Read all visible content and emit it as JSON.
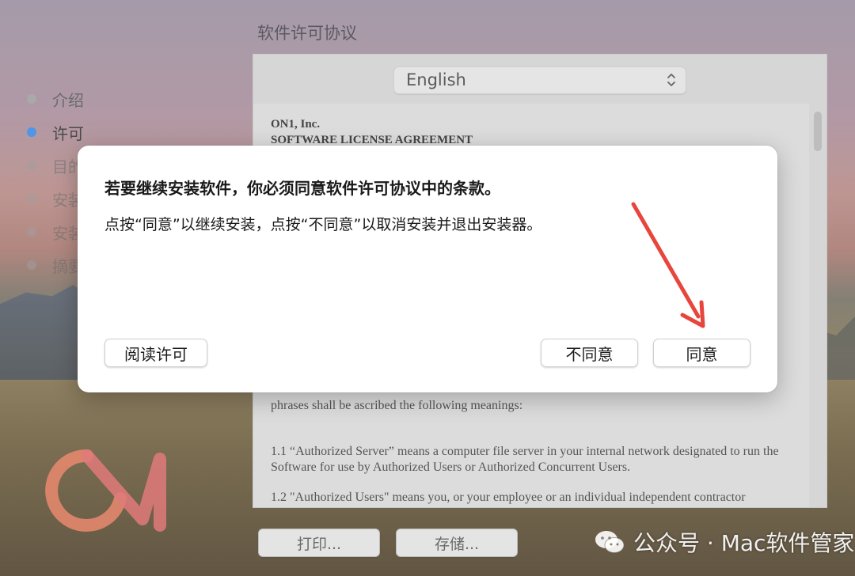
{
  "window": {
    "title": "软件许可协议"
  },
  "sidebar": {
    "steps": [
      {
        "label": "介绍",
        "state": "done"
      },
      {
        "label": "许可",
        "state": "active"
      },
      {
        "label": "目的",
        "state": "faded"
      },
      {
        "label": "安装",
        "state": "faded"
      },
      {
        "label": "安装",
        "state": "faded"
      },
      {
        "label": "摘要",
        "state": "faded"
      }
    ]
  },
  "license": {
    "language_selected": "English",
    "company": "ON1, Inc.",
    "heading": "SOFTWARE LICENSE AGREEMENT",
    "para_phrases": "phrases shall be ascribed the following meanings:",
    "para_1_1": "1.1 “Authorized Server” means a computer file server in your internal network designated to run the Software for use by Authorized Users or Authorized Concurrent Users.",
    "para_1_2": "1.2 \"Authorized Users\" means you, or your employee or an individual independent contractor"
  },
  "footer": {
    "print_label": "打印...",
    "save_label": "存储..."
  },
  "dialog": {
    "title": "若要继续安装软件，你必须同意软件许可协议中的条款。",
    "message": "点按“同意”以继续安装，点按“不同意”以取消安装并退出安装器。",
    "read_label": "阅读许可",
    "disagree_label": "不同意",
    "agree_label": "同意"
  },
  "watermark": {
    "text": "公众号 · Mac软件管家"
  },
  "colors": {
    "accent": "#4f95e8",
    "arrow": "#e8453c",
    "logo": "#e9896f"
  }
}
